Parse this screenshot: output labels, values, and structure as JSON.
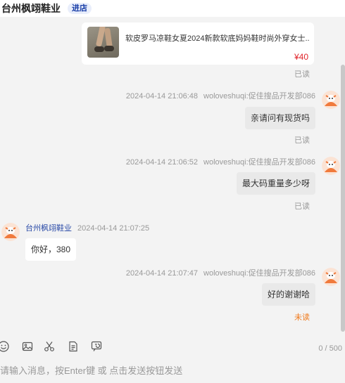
{
  "header": {
    "shop_name": "台州枫翊鞋业",
    "enter_shop_label": "进店"
  },
  "product": {
    "title": "软皮罗马凉鞋女夏2024新款软底妈妈鞋时尚外穿女士...",
    "price": "¥40",
    "status": "已读"
  },
  "messages": [
    {
      "direction": "out",
      "time": "2024-04-14 21:06:48",
      "sender": "woloveshuqi:促佳搜品开发部086",
      "text": "亲请问有现货吗",
      "status": "已读"
    },
    {
      "direction": "out",
      "time": "2024-04-14 21:06:52",
      "sender": "woloveshuqi:促佳搜品开发部086",
      "text": "最大码重量多少呀",
      "status": "已读"
    },
    {
      "direction": "in",
      "time": "2024-04-14 21:07:25",
      "sender": "台州枫翊鞋业",
      "text": "你好，380"
    },
    {
      "direction": "out",
      "time": "2024-04-14 21:07:47",
      "sender": "woloveshuqi:促佳搜品开发部086",
      "text": "好的谢谢哈",
      "status": "未读"
    }
  ],
  "toolbar": {
    "icons": [
      "emoji-icon",
      "image-icon",
      "scissors-icon",
      "order-icon",
      "history-icon"
    ],
    "counter": "0 / 500"
  },
  "input": {
    "placeholder": "请输入消息，按Enter键 或 点击发送按钮发送"
  },
  "colors": {
    "accent_link": "#2a4aa7",
    "price": "#e0242a",
    "unread": "#f07a1c",
    "avatar": "#f07a3c"
  }
}
